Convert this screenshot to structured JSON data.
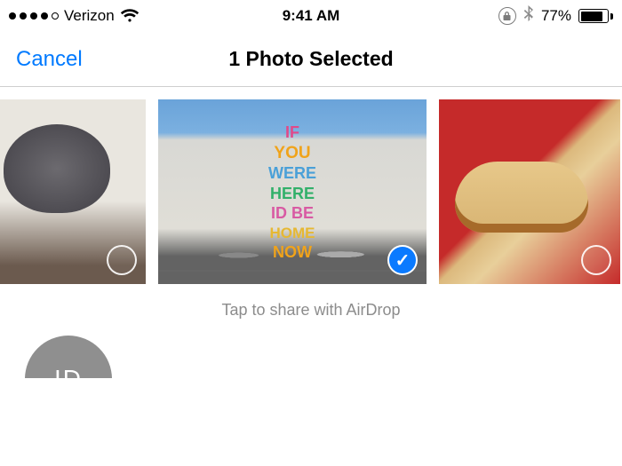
{
  "status": {
    "carrier": "Verizon",
    "signal_dots_filled": 4,
    "signal_dots_total": 5,
    "time": "9:41 AM",
    "battery_percent_label": "77%",
    "battery_percent": 77
  },
  "nav": {
    "cancel_label": "Cancel",
    "title": "1 Photo Selected"
  },
  "photos": [
    {
      "desc": "Gray cat sitting on a box indoors",
      "selected": false
    },
    {
      "desc": "White brick wall mural with colorful lettering",
      "selected": true,
      "mural_lines": [
        "IF",
        "YOU",
        "WERE",
        "HERE",
        "ID BE",
        "HOME",
        "NOW"
      ]
    },
    {
      "desc": "Hot dog in a bun on a red tray",
      "selected": false
    }
  ],
  "hint": "Tap to share with AirDrop",
  "airdrop_contact": {
    "initials": "ID"
  }
}
